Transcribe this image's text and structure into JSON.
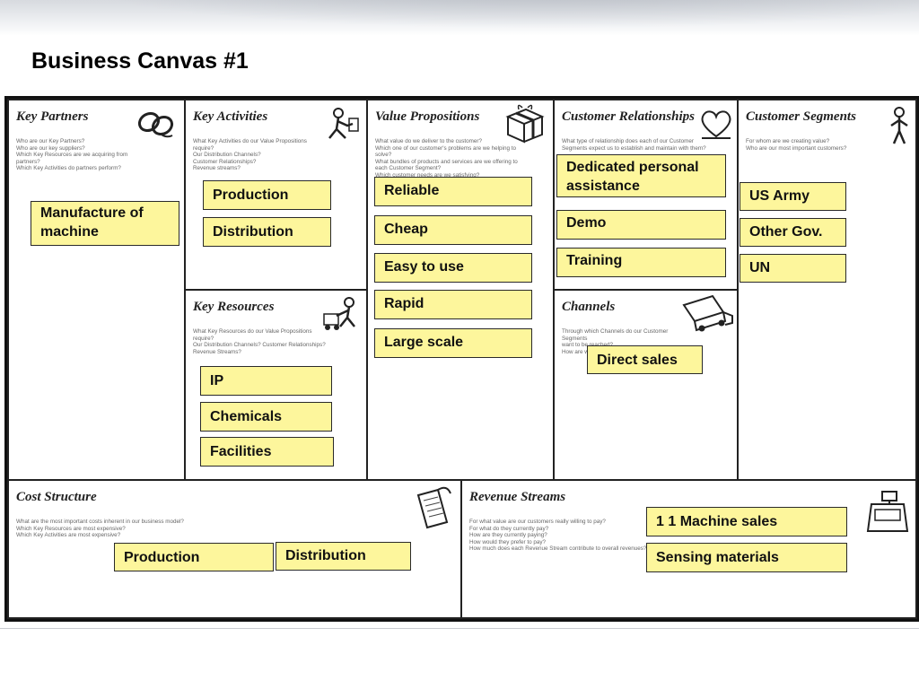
{
  "slide": {
    "title": "Business Canvas #1"
  },
  "blocks": {
    "key_partners": {
      "title": "Key Partners",
      "questions": "Who are our Key Partners?\nWho are our key suppliers?\nWhich Key Resources are we acquiring from partners?\nWhich Key Activities do partners perform?",
      "icon": "chain-link-icon"
    },
    "key_activities": {
      "title": "Key Activities",
      "questions": "What Key Activities do our Value Propositions require?\nOur Distribution Channels?\nCustomer Relationships?\nRevenue streams?",
      "icon": "worker-icon"
    },
    "value_propositions": {
      "title": "Value Propositions",
      "questions": "What value do we deliver to the customer?\nWhich one of our customer's problems are we helping to solve?\nWhat bundles of products and services are we offering to each Customer Segment?\nWhich customer needs are we satisfying?",
      "icon": "gift-box-icon"
    },
    "customer_relationships": {
      "title": "Customer Relationships",
      "questions": "What type of relationship does each of our Customer\nSegments expect us to establish and maintain with them?",
      "icon": "heart-icon"
    },
    "customer_segments": {
      "title": "Customer Segments",
      "questions": "For whom are we creating value?\nWho are our most important customers?",
      "icon": "person-icon"
    },
    "key_resources": {
      "title": "Key Resources",
      "questions": "What Key Resources do our Value Propositions require?\nOur Distribution Channels? Customer Relationships?\nRevenue Streams?",
      "icon": "forklift-worker-icon"
    },
    "channels": {
      "title": "Channels",
      "questions": "Through which Channels do our Customer Segments\nwant to be reached?\nHow are we reaching them now?",
      "icon": "delivery-truck-icon"
    },
    "cost_structure": {
      "title": "Cost Structure",
      "questions": "What are the most important costs inherent in our business model?\nWhich Key Resources are most expensive?\nWhich Key Activities are most expensive?",
      "icon": "receipt-pages-icon"
    },
    "revenue_streams": {
      "title": "Revenue Streams",
      "questions": "For what value are our customers really willing to pay?\nFor what do they currently pay?\nHow are they currently paying?\nHow would they prefer to pay?\nHow much does each Revenue Stream contribute to overall revenues?",
      "icon": "cash-register-icon"
    }
  },
  "notes": {
    "key_partners": [
      "Manufacture of machine"
    ],
    "key_activities": [
      "Production",
      "Distribution"
    ],
    "value_propositions": [
      "Reliable",
      "Cheap",
      "Easy to use",
      "Rapid",
      "Large scale"
    ],
    "customer_relationships": [
      "Dedicated personal assistance",
      "Demo",
      "Training"
    ],
    "customer_segments": [
      "US Army",
      "Other Gov.",
      "UN"
    ],
    "key_resources": [
      "IP",
      "Chemicals",
      "Facilities"
    ],
    "channels": [
      "Direct sales"
    ],
    "cost_structure": [
      "Production",
      "Distribution"
    ],
    "revenue_streams": [
      "1 1 Machine sales",
      "Sensing materials"
    ]
  },
  "colors": {
    "note_fill": "#fdf69c",
    "border": "#222222"
  }
}
